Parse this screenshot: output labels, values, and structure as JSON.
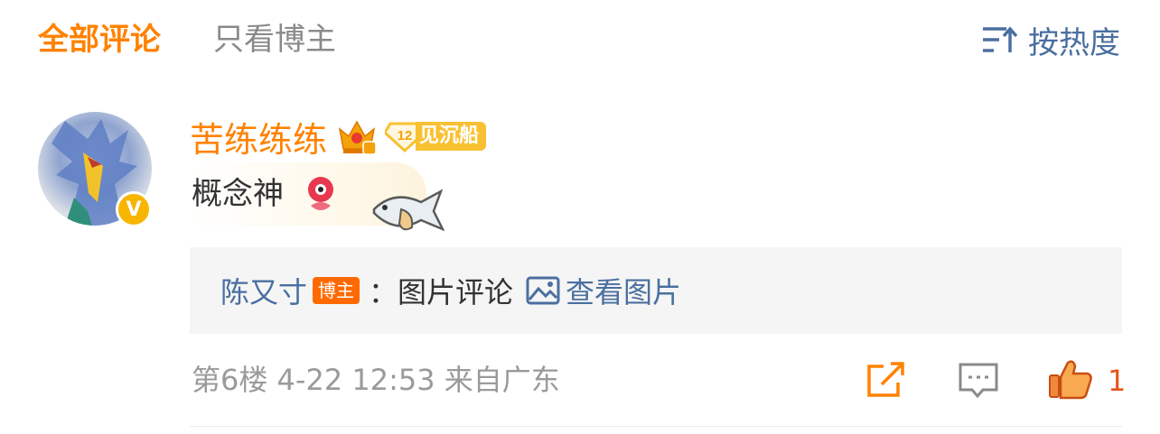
{
  "tabs": [
    {
      "label": "全部评论",
      "active": true
    },
    {
      "label": "只看博主",
      "active": false
    }
  ],
  "sort": {
    "label": "按热度",
    "icon": "sort-icon"
  },
  "comment": {
    "username": "苦练练练",
    "level_badge": {
      "number": "12",
      "text": "见沉船"
    },
    "text": "概念神",
    "floor": "第6楼",
    "time": "4-22 12:53",
    "location": "来自广东",
    "likes": "1"
  },
  "reply": {
    "author": "陈又寸",
    "author_badge": "博主",
    "separator": "：",
    "content": "图片评论",
    "view_label": "查看图片"
  },
  "colors": {
    "accent": "#ff8200",
    "link": "#4a6fa0",
    "muted": "#9a9a9a",
    "like": "#e8541e"
  }
}
